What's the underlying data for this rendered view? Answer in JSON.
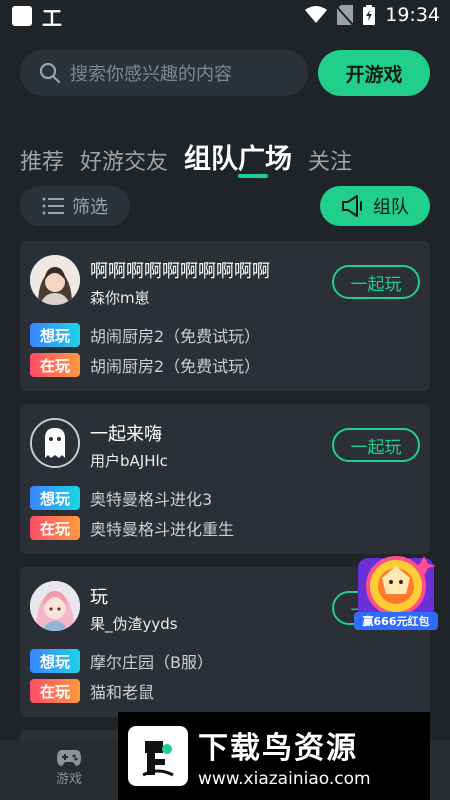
{
  "status_bar": {
    "app_icon": "工",
    "time": "19:34"
  },
  "search": {
    "placeholder": "搜索你感兴趣的内容"
  },
  "play_button": "开游戏",
  "tabs": [
    "推荐",
    "好游交友",
    "组队广场",
    "关注"
  ],
  "filter_label": "筛选",
  "team_label": "组队",
  "tags": {
    "want": "想玩",
    "playing": "在玩"
  },
  "cards": [
    {
      "title": "啊啊啊啊啊啊啊啊啊啊",
      "name": "森你m崽",
      "want_game": "胡闹厨房2（免费试玩）",
      "playing_game": "胡闹厨房2（免费试玩）",
      "action": "一起玩"
    },
    {
      "title": "一起来嗨",
      "name": "用户bAJHlc",
      "want_game": "奥特曼格斗进化3",
      "playing_game": "奥特曼格斗进化重生",
      "action": "一起玩"
    },
    {
      "title": "玩",
      "name": "果_伪渣yyds",
      "want_game": "摩尔庄园（B服）",
      "playing_game": "猫和老鼠",
      "action": "一起玩"
    }
  ],
  "red_packet": "赢666元红包",
  "watermark": {
    "title": "下载鸟资源",
    "url": "www.xiazainiao.com"
  },
  "bottom_nav": {
    "games": "游戏"
  },
  "colors": {
    "accent": "#1fcf8b",
    "background": "#1f2428",
    "card": "#2a3035"
  }
}
